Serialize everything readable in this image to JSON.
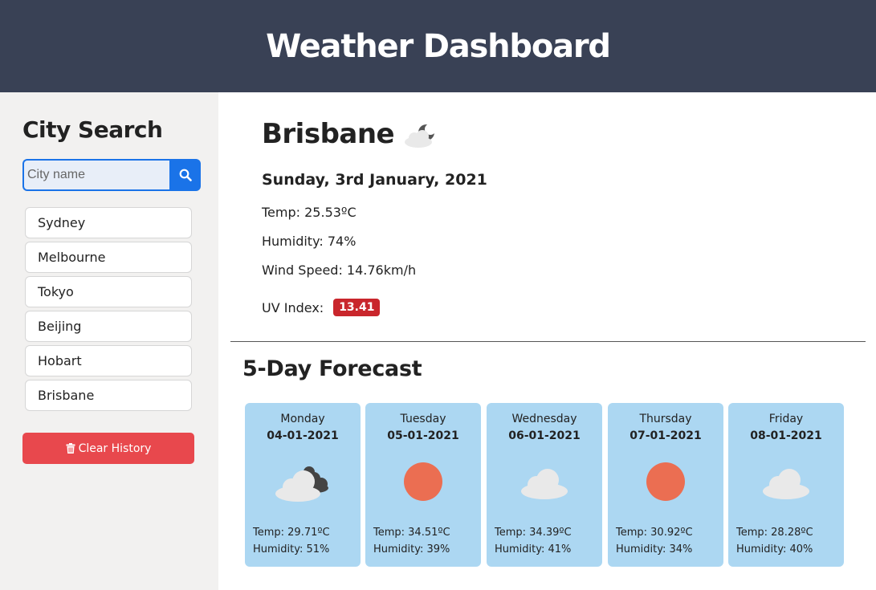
{
  "header": {
    "title": "Weather Dashboard"
  },
  "sidebar": {
    "title": "City Search",
    "search": {
      "placeholder": "City name",
      "value": ""
    },
    "history": [
      "Sydney",
      "Melbourne",
      "Tokyo",
      "Beijing",
      "Hobart",
      "Brisbane"
    ],
    "clear_label": "Clear History"
  },
  "current": {
    "city": "Brisbane",
    "icon": "partly-cloudy-night-icon",
    "date": "Sunday, 3rd January, 2021",
    "temp": "Temp: 25.53ºC",
    "humidity": "Humidity: 74%",
    "wind": "Wind Speed: 14.76km/h",
    "uv_label": "UV Index:",
    "uv_value": "13.41"
  },
  "forecast": {
    "title": "5-Day Forecast",
    "days": [
      {
        "day": "Monday",
        "date": "04-01-2021",
        "icon": "cloud-with-dark-cloud-icon",
        "temp": "Temp: 29.71ºC",
        "humidity": "Humidity: 51%"
      },
      {
        "day": "Tuesday",
        "date": "05-01-2021",
        "icon": "sun-icon",
        "temp": "Temp: 34.51ºC",
        "humidity": "Humidity: 39%"
      },
      {
        "day": "Wednesday",
        "date": "06-01-2021",
        "icon": "cloud-icon",
        "temp": "Temp: 34.39ºC",
        "humidity": "Humidity: 41%"
      },
      {
        "day": "Thursday",
        "date": "07-01-2021",
        "icon": "sun-icon",
        "temp": "Temp: 30.92ºC",
        "humidity": "Humidity: 34%"
      },
      {
        "day": "Friday",
        "date": "08-01-2021",
        "icon": "cloud-icon",
        "temp": "Temp: 28.28ºC",
        "humidity": "Humidity: 40%"
      }
    ]
  },
  "colors": {
    "header_bg": "#394155",
    "sidebar_bg": "#f2f1f0",
    "search_button": "#1a73e8",
    "clear_button": "#e8484d",
    "uv_badge": "#c9262c",
    "card_bg": "#acd7f2",
    "sun": "#eb6e52"
  }
}
